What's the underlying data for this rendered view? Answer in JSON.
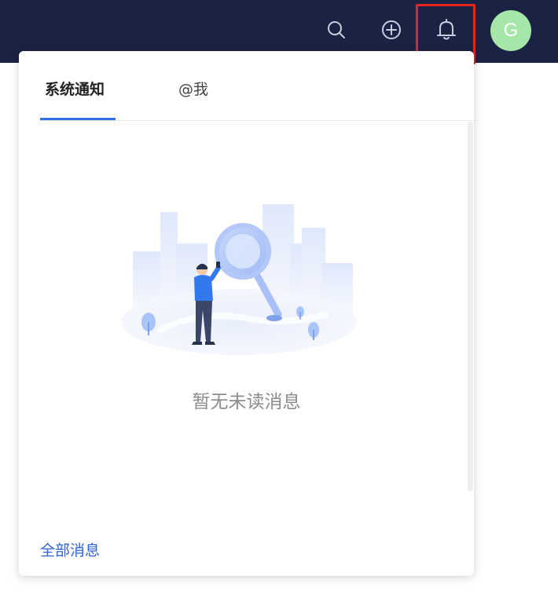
{
  "header": {
    "avatar_letter": "G",
    "avatar_color": "#a6e6a8",
    "background_color": "#1b2344",
    "icons": [
      "search-icon",
      "plus-circle-icon",
      "bell-icon"
    ],
    "highlight_color": "#e8231f"
  },
  "notifications": {
    "tabs": [
      {
        "label": "系统通知",
        "active": true
      },
      {
        "label": "@我",
        "active": false
      }
    ],
    "empty_message": "暂无未读消息",
    "all_messages_link": "全部消息",
    "accent_color": "#2f6fe4"
  }
}
